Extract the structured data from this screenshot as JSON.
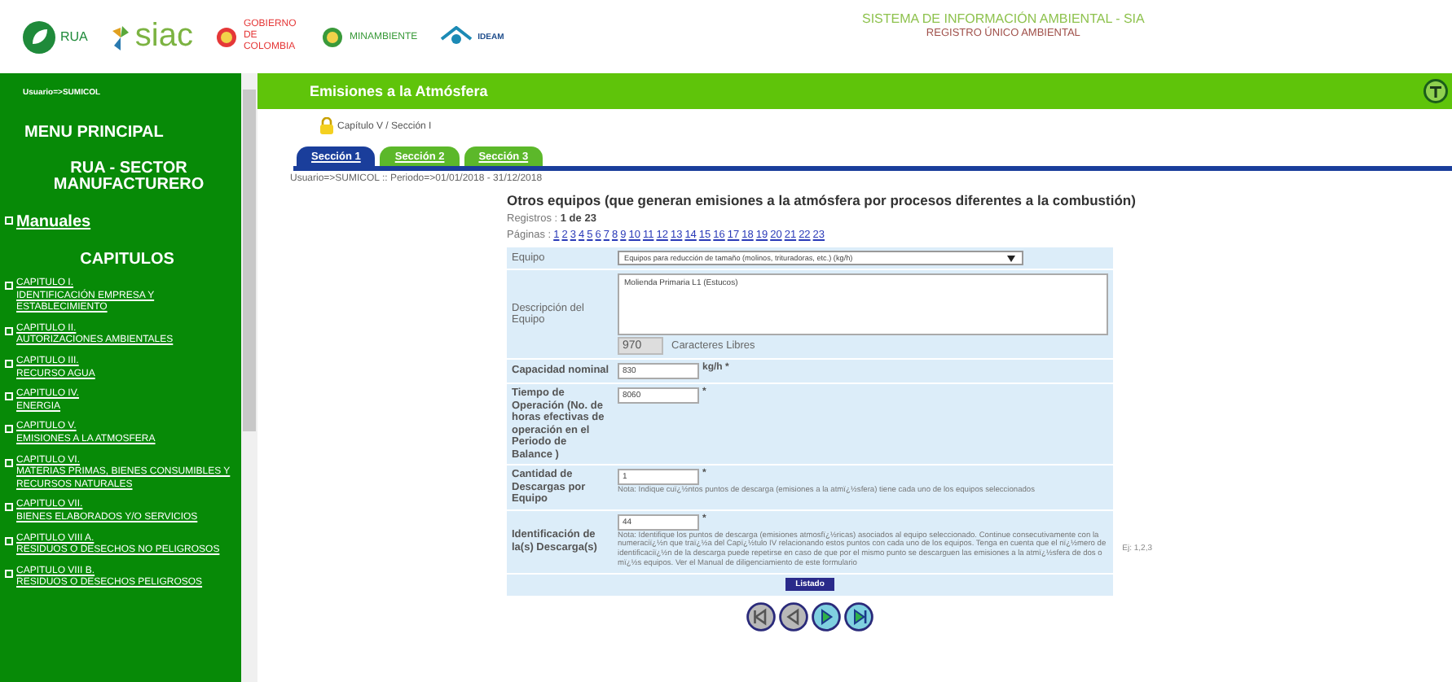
{
  "header": {
    "logos": [
      {
        "kind": "rua",
        "text": "RUA"
      },
      {
        "kind": "siac",
        "text": "siac"
      },
      {
        "kind": "gobierno",
        "text": "GOBIERNO DE COLOMBIA"
      },
      {
        "kind": "minambiente",
        "text": "MINAMBIENTE"
      },
      {
        "kind": "ideam",
        "text": "IDEAM"
      }
    ],
    "title": "SISTEMA DE INFORMACIÓN AMBIENTAL - SIA",
    "subtitle": "REGISTRO ÚNICO AMBIENTAL"
  },
  "sidebar": {
    "user": "Usuario=>SUMICOL",
    "menu_title": "MENU PRINCIPAL",
    "sector": "RUA - SECTOR MANUFACTURERO",
    "manuals": "Manuales",
    "chapters_title": "CAPITULOS",
    "chapters": [
      {
        "title": "CAPITULO I.",
        "subtitle": "IDENTIFICACIÓN EMPRESA Y ESTABLECIMIENTO"
      },
      {
        "title": "CAPITULO II.",
        "subtitle": "AUTORIZACIONES AMBIENTALES"
      },
      {
        "title": "CAPITULO III.",
        "subtitle": "RECURSO AGUA"
      },
      {
        "title": "CAPITULO IV.",
        "subtitle": "ENERGIA"
      },
      {
        "title": "CAPITULO V.",
        "subtitle": "EMISIONES A LA ATMOSFERA"
      },
      {
        "title": "CAPITULO VI.",
        "subtitle": "MATERIAS PRIMAS, BIENES CONSUMIBLES Y RECURSOS NATURALES"
      },
      {
        "title": "CAPITULO VII.",
        "subtitle": "BIENES ELABORADOS Y/O SERVICIOS"
      },
      {
        "title": "CAPITULO VIII A.",
        "subtitle": "RESIDUOS O DESECHOS NO PELIGROSOS"
      },
      {
        "title": "CAPITULO VIII B.",
        "subtitle": "RESIDUOS O DESECHOS PELIGROSOS"
      }
    ]
  },
  "main": {
    "title": "Emisiones a la Atmósfera",
    "breadcrumb": "Capítulo V / Sección I",
    "tabs": [
      {
        "label": "Sección 1",
        "selected": true
      },
      {
        "label": "Sección 2",
        "selected": false
      },
      {
        "label": "Sección 3",
        "selected": false
      }
    ],
    "period": "Usuario=>SUMICOL :: Periodo=>01/01/2018 - 31/12/2018",
    "form_title": "Otros equipos (que generan emisiones a la atmósfera por procesos diferentes a la combustión)",
    "records_label": "Registros :",
    "records_value": "1 de 23",
    "pages_label": "Páginas :",
    "pages": [
      "1",
      "2",
      "3",
      "4",
      "5",
      "6",
      "7",
      "8",
      "9",
      "10",
      "11",
      "12",
      "13",
      "14",
      "15",
      "16",
      "17",
      "18",
      "19",
      "20",
      "21",
      "22",
      "23"
    ],
    "fields": [
      {
        "kind": "select",
        "label": "Equipo",
        "value": "Equipos para reducción de tamaño (molinos, trituradoras, etc.) (kg/h)"
      },
      {
        "kind": "textarea",
        "label": "Descripción del Equipo",
        "value": "Molienda Primaria L1 (Estucos)",
        "counter": "970",
        "counter_label": "Caracteres Libres"
      },
      {
        "kind": "input",
        "label": "Capacidad nominal",
        "value": "830",
        "unit": "kg/h *"
      },
      {
        "kind": "input",
        "label": "Tiempo de Operación (No. de horas efectivas de operación en el Periodo de Balance )",
        "value": "8060",
        "unit": "*"
      },
      {
        "kind": "input",
        "label": "Cantidad de Descargas por Equipo",
        "value": "1",
        "unit": "*",
        "note": "Nota: Indique cuï¿½ntos puntos de descarga (emisiones a la atmï¿½sfera) tiene cada uno de los equipos seleccionados"
      },
      {
        "kind": "input",
        "label": "Identificación de la(s) Descarga(s)",
        "value": "44",
        "unit": "*",
        "note": "Nota: Identifique los puntos de descarga (emisiones atmosfï¿½ricas) asociados al equipo seleccionado. Continue consecutivamente con la numeraciï¿½n que traï¿½a del Capï¿½tulo IV relacionando estos puntos con cada uno de los equipos. Tenga en cuenta que el nï¿½mero de identificaciï¿½n de la descarga puede repetirse en caso de que por el mismo punto se descarguen las emisiones a la atmï¿½sfera de dos o mï¿½s equipos. Ver el Manual de diligenciamiento de este formulario",
        "hint": "Ej: 1,2,3"
      }
    ],
    "list_button": "Listado"
  }
}
